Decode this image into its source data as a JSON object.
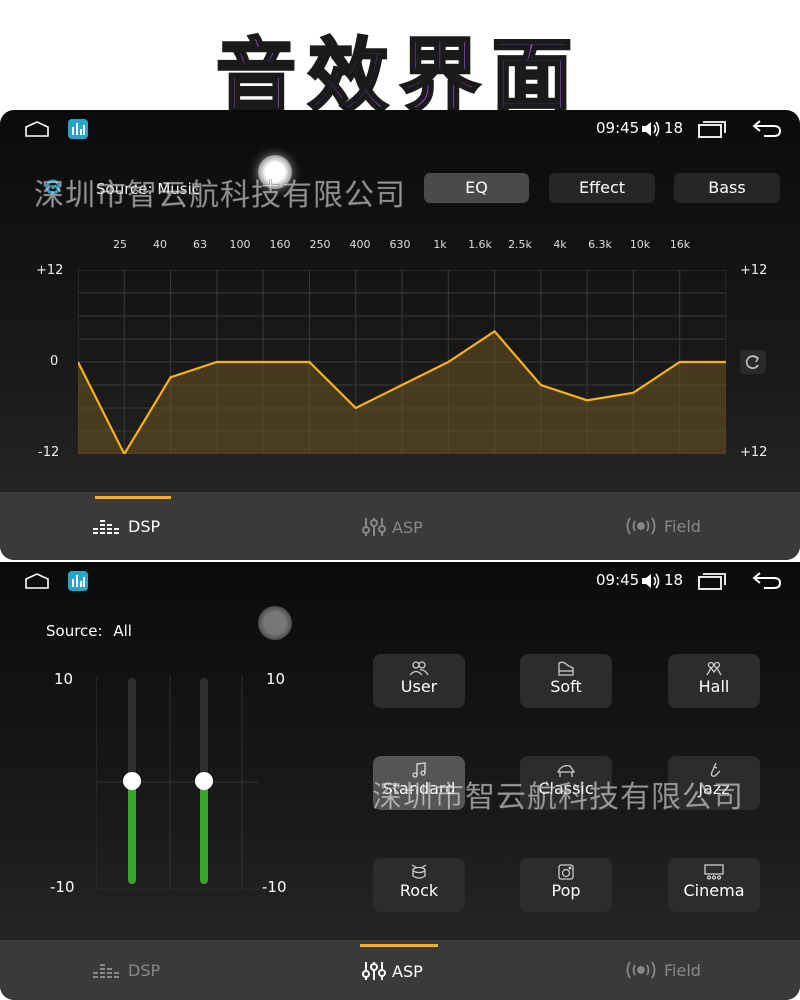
{
  "banner": {
    "title": "音效界面"
  },
  "status": {
    "time": "09:45",
    "volume": "18"
  },
  "screen1": {
    "source": "Source: Music",
    "buttons": [
      "EQ",
      "Effect",
      "Bass"
    ],
    "active_button": "EQ",
    "freqs": [
      "25",
      "40",
      "63",
      "100",
      "160",
      "250",
      "400",
      "630",
      "1k",
      "1.6k",
      "2.5k",
      "4k",
      "6.3k",
      "10k",
      "16k"
    ],
    "left_axis": [
      "+12",
      "0",
      "-12"
    ],
    "right_axis": [
      "+12",
      "+12"
    ],
    "watermark": "深圳市智云航科技有限公司"
  },
  "chart_data": {
    "type": "line",
    "categories": [
      "25",
      "40",
      "63",
      "100",
      "160",
      "250",
      "400",
      "630",
      "1k",
      "1.6k",
      "2.5k",
      "4k",
      "6.3k",
      "10k",
      "16k"
    ],
    "values": [
      0,
      -12,
      -2,
      0,
      0,
      0,
      -6,
      -3,
      0,
      4,
      -3,
      -5,
      -4,
      0,
      0
    ],
    "ylim": [
      -12,
      12
    ],
    "colors": {
      "line": "#f5b21a",
      "fill": "#6b5420"
    }
  },
  "tabs": [
    "DSP",
    "ASP",
    "Field"
  ],
  "screen2": {
    "source_label": "Source:",
    "source_value": "All",
    "scale_top": "10",
    "scale_bottom": "-10",
    "slider_values": [
      0,
      0
    ],
    "presets": [
      {
        "label": "User",
        "icon": "users-icon"
      },
      {
        "label": "Soft",
        "icon": "piano-icon"
      },
      {
        "label": "Hall",
        "icon": "hall-icon"
      },
      {
        "label": "Standard",
        "icon": "music-note-icon"
      },
      {
        "label": "Classic",
        "icon": "grand-piano-icon"
      },
      {
        "label": "Jazz",
        "icon": "saxophone-icon"
      },
      {
        "label": "Rock",
        "icon": "drum-icon"
      },
      {
        "label": "Pop",
        "icon": "speaker-icon"
      },
      {
        "label": "Cinema",
        "icon": "cinema-icon"
      }
    ],
    "active_preset": "Standard",
    "watermark": "深圳市智云航科技有限公司"
  }
}
